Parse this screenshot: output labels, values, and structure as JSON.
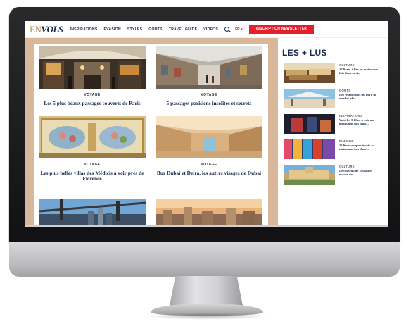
{
  "nav": {
    "logo_left": "EN",
    "logo_right": "VOLS",
    "items": [
      "INSPIRATIONS",
      "EVASION",
      "STYLES",
      "GOÛTS",
      "TRAVEL GUIDE",
      "VIDÉOS"
    ],
    "lang": "FR ▾",
    "newsletter": "INSCRIPTION NEWSLETTER"
  },
  "articles": [
    {
      "category": "VOYAGE",
      "title": "Les 5 plus beaux passages couverts de Paris",
      "image": "paris-covered-passage"
    },
    {
      "category": "VOYAGE",
      "title": "5 passages parisiens insolites et secrets",
      "image": "parisian-arcade"
    },
    {
      "category": "VOYAGE",
      "title": "Les plus belles villas des Médicis à voir près de Florence",
      "image": "painted-villa-ceiling"
    },
    {
      "category": "VOYAGE",
      "title": "Bur Dubaï et Deira, les autres visages de Dubaï",
      "image": "dubai-sand-alley"
    },
    {
      "category": "",
      "title": "",
      "image": "bridge-skyline"
    },
    {
      "category": "",
      "title": "",
      "image": "city-sunset"
    }
  ],
  "sidebar": {
    "title": "LES + LUS",
    "items": [
      {
        "category": "CULTURE",
        "title": "12 livres à lire au moins une fois dans sa vie",
        "image": "books"
      },
      {
        "category": "GOÛTS",
        "title": "Les restaurants du bord de mer les plus...",
        "image": "seaside-restaurant"
      },
      {
        "category": "INSPIRATIONS",
        "title": "Voici les 5 films à voir au moins une fois dans ...",
        "image": "film-scene"
      },
      {
        "category": "EVASION",
        "title": "15 lieux uniques à voir au moins une fois dans ...",
        "image": "colorful-place"
      },
      {
        "category": "CULTURE",
        "title": "Le château de Versailles ouvert des...",
        "image": "versailles"
      }
    ]
  },
  "colors": {
    "navy": "#1b2a4a",
    "accent_red": "#e3202b",
    "sand": "#d8b79a"
  }
}
